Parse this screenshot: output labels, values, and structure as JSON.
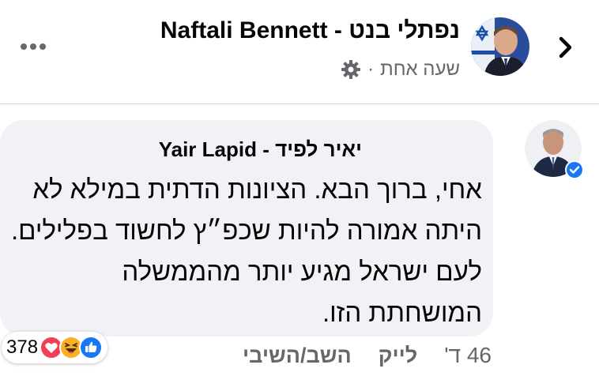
{
  "post": {
    "author": "Naftali Bennett - נפתלי בנט",
    "time": "שעה אחת",
    "separator": "·",
    "audience_icon": "gear-icon"
  },
  "nav": {
    "back_icon": "chevron-right-icon",
    "more_icon": "more-horizontal-icon"
  },
  "comment": {
    "author": "Yair Lapid - יאיר לפיד",
    "verified": true,
    "text": "אחי, ברוך הבא. הציונות הדתית במילא לא היתה אמורה להיות שכפ״ץ לחשוד בפלילים. לעם ישראל מגיע יותר מהממשלה המושחתת הזו.",
    "reactions": {
      "count": "378",
      "types": [
        "like",
        "haha",
        "love"
      ]
    },
    "actions": {
      "time": "46 ד'",
      "like": "לייק",
      "reply": "השב/השיבי"
    }
  },
  "colors": {
    "bubble": "#f0f2f5",
    "secondary_text": "#65676b",
    "like_blue": "#1877f2",
    "love_red": "#f33e58",
    "haha_yellow": "#f7b125",
    "verified_blue": "#1877f2"
  }
}
